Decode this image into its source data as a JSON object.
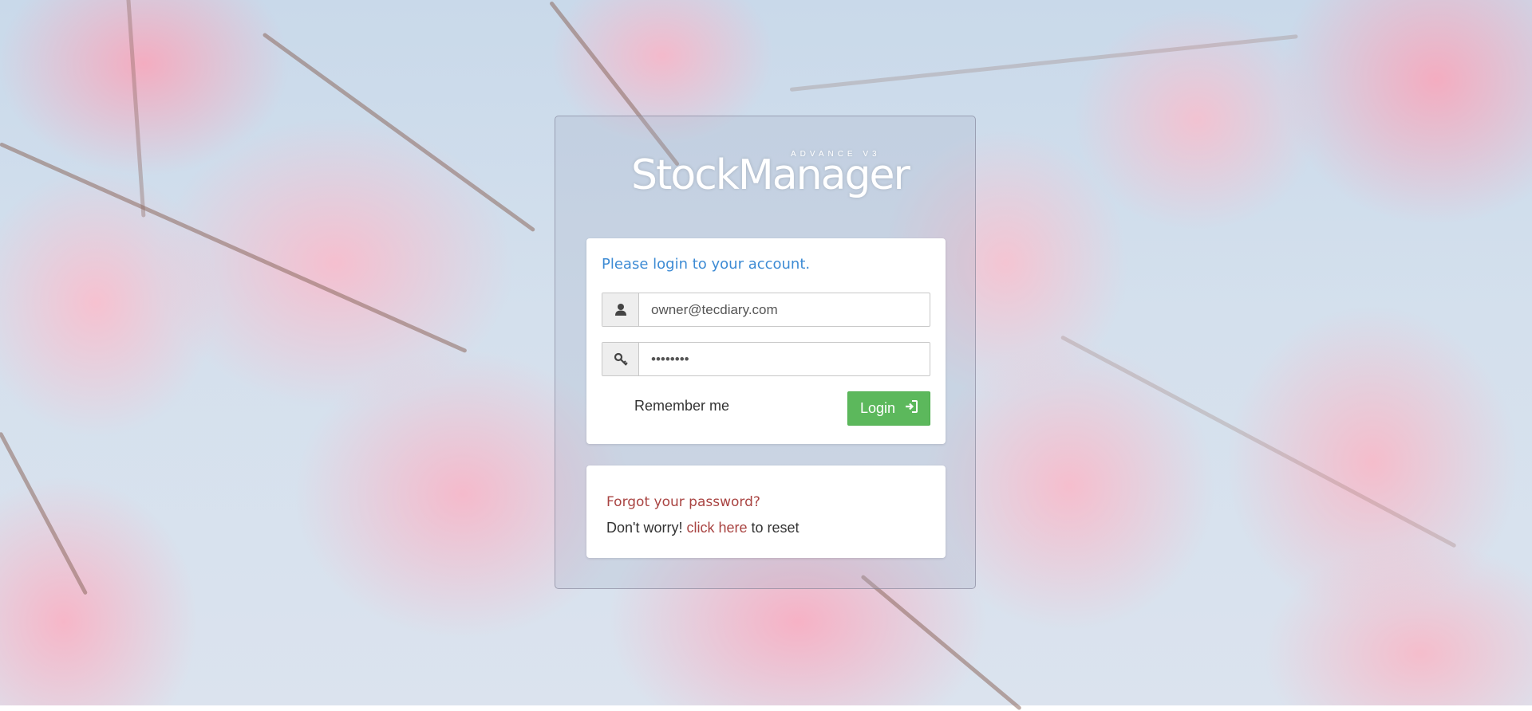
{
  "logo": {
    "name": "StockManager",
    "tagline": "ADVANCE V3"
  },
  "login": {
    "title": "Please login to your account.",
    "username_value": "owner@tecdiary.com",
    "password_value": "••••••••",
    "remember_label": "Remember me",
    "login_button_label": "Login",
    "icons": {
      "user": "user-icon",
      "password": "key-icon",
      "login": "sign-in-icon"
    }
  },
  "forgot": {
    "title": "Forgot your password?",
    "text_before": "Don't worry!",
    "link_text": "click here",
    "text_after": "to reset"
  },
  "colors": {
    "title_blue": "#3d8bd4",
    "button_green": "#5cb85c",
    "forgot_red": "#a94442"
  }
}
